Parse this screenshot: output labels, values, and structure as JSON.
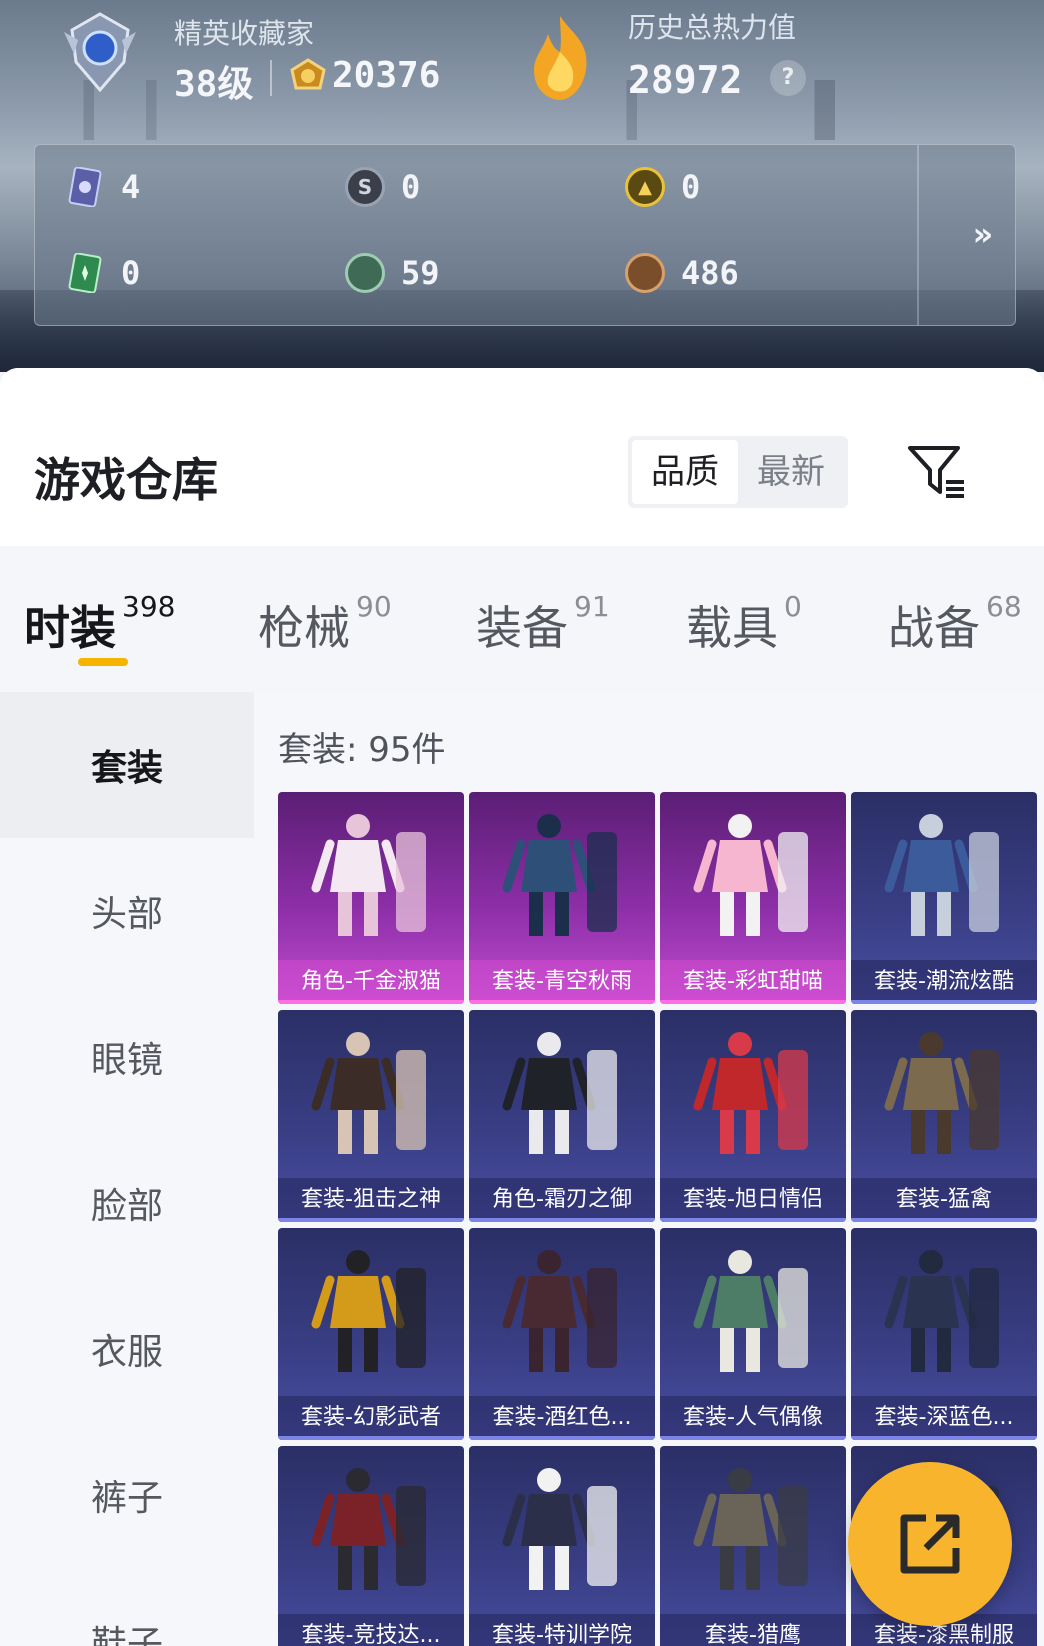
{
  "header": {
    "rank_title": "精英收藏家",
    "level": "38级",
    "coins": "20376",
    "heat_title": "历史总热力值",
    "heat_value": "28972",
    "help": "?"
  },
  "stats": [
    {
      "icon": "card-ticket-icon",
      "value": "4"
    },
    {
      "icon": "silver-coin-icon",
      "value": "0"
    },
    {
      "icon": "gold-coin-icon",
      "value": "0"
    },
    {
      "icon": "green-card-icon",
      "value": "0"
    },
    {
      "icon": "green-token-icon",
      "value": "59"
    },
    {
      "icon": "bronze-token-icon",
      "value": "486"
    }
  ],
  "more": "»",
  "warehouse": {
    "title": "游戏仓库",
    "sort_options": [
      "品质",
      "最新"
    ],
    "active_sort": "品质"
  },
  "categories": [
    {
      "label": "时装",
      "count": "398"
    },
    {
      "label": "枪械",
      "count": "90"
    },
    {
      "label": "装备",
      "count": "91"
    },
    {
      "label": "载具",
      "count": "0"
    },
    {
      "label": "战备",
      "count": "68"
    }
  ],
  "sidebar": [
    "套装",
    "头部",
    "眼镜",
    "脸部",
    "衣服",
    "裤子",
    "鞋子"
  ],
  "suit_count_label": "套装: 95件",
  "items": [
    {
      "name": "角色-千金淑猫",
      "rarity": "purple"
    },
    {
      "name": "套装-青空秋雨",
      "rarity": "purple"
    },
    {
      "name": "套装-彩虹甜喵",
      "rarity": "purple"
    },
    {
      "name": "套装-潮流炫酷",
      "rarity": "blue"
    },
    {
      "name": "套装-狙击之神",
      "rarity": "blue"
    },
    {
      "name": "角色-霜刃之御",
      "rarity": "blue"
    },
    {
      "name": "套装-旭日情侣",
      "rarity": "blue"
    },
    {
      "name": "套装-猛禽",
      "rarity": "blue"
    },
    {
      "name": "套装-幻影武者",
      "rarity": "blue"
    },
    {
      "name": "套装-酒红色...",
      "rarity": "blue"
    },
    {
      "name": "套装-人气偶像",
      "rarity": "blue"
    },
    {
      "name": "套装-深蓝色...",
      "rarity": "blue"
    },
    {
      "name": "套装-竞技达...",
      "rarity": "blue"
    },
    {
      "name": "套装-特训学院",
      "rarity": "blue"
    },
    {
      "name": "套装-猎鹰",
      "rarity": "blue"
    },
    {
      "name": "套装-漆黑制服",
      "rarity": "blue"
    }
  ],
  "colors": {
    "accent": "#f4b400",
    "fab": "#f7b42c",
    "purple_tile": "#8d2fa8",
    "blue_tile": "#3a3f86"
  }
}
